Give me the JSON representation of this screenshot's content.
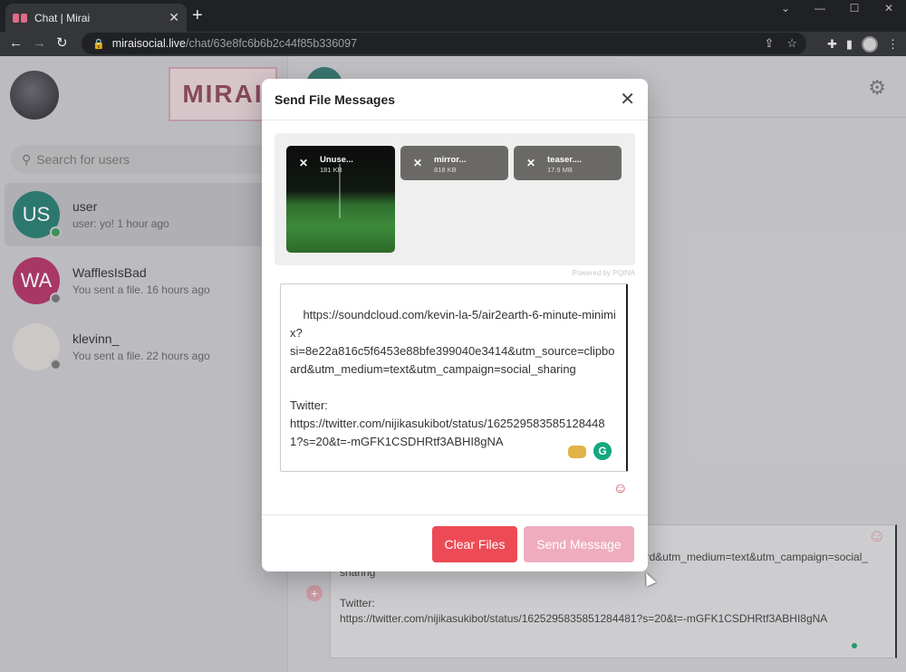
{
  "browser": {
    "tab_title": "Chat | Mirai",
    "tab_close": "✕",
    "new_tab": "+",
    "url_host": "miraisocial.live",
    "url_path": "/chat/63e8fc6b6b2c44f85b336097"
  },
  "sidebar": {
    "logo_text": "MIRAI",
    "search_placeholder": "Search for users",
    "users": [
      {
        "initials": "US",
        "name": "user",
        "preview": "user: yo!  1 hour ago",
        "avatar_color": "#2b7d73",
        "status_color": "#3b9a59"
      },
      {
        "initials": "WA",
        "name": "WafflesIsBad",
        "preview": "You sent a file.  16 hours ago",
        "avatar_color": "#b13769",
        "status_color": "#777777"
      },
      {
        "initials": "",
        "name": "klevinn_",
        "preview": "You sent a file.  22 hours ago",
        "avatar_color": "#d8d4d2",
        "status_color": "#777777"
      }
    ]
  },
  "chat": {
    "composer_text": "ix?\nsi=8e22a816c5f6453e88bfe399040e3414&utm_source=clipboard&utm_medium=text&utm_campaign=social_sharing\n\nTwitter:\nhttps://twitter.com/nijikasukibot/status/1625295835851284481?s=20&t=-mGFK1CSDHRtf3ABHI8gNA"
  },
  "modal": {
    "title": "Send File Messages",
    "close": "✕",
    "files": [
      {
        "name": "Unuse...",
        "size": "181 KB",
        "kind": "image"
      },
      {
        "name": "mirror...",
        "size": "818 KB",
        "kind": "file"
      },
      {
        "name": "teaser....",
        "size": "17.9 MB",
        "kind": "file"
      }
    ],
    "powered_by": "Powered by PQINA",
    "message": "https://soundcloud.com/kevin-la-5/air2earth-6-minute-minimix?\nsi=8e22a816c5f6453e88bfe399040e3414&utm_source=clipboard&utm_medium=text&utm_campaign=social_sharing\n\nTwitter:\nhttps://twitter.com/nijikasukibot/status/1625295835851284481?s=20&t=-mGFK1CSDHRtf3ABHI8gNA",
    "clear_label": "Clear Files",
    "send_label": "Send Message"
  }
}
